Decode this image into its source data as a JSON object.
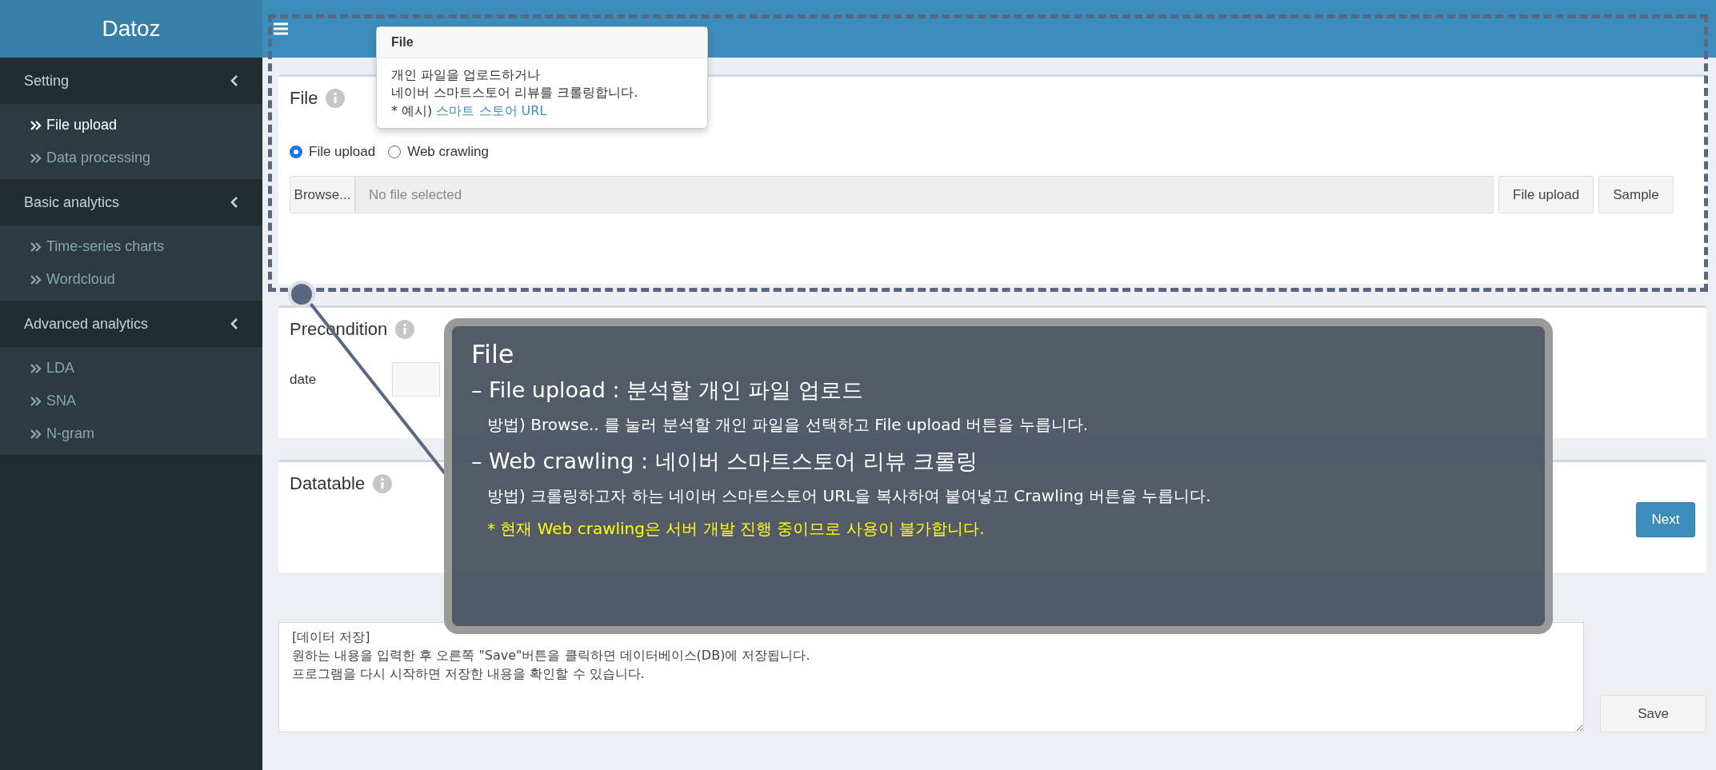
{
  "sidebar": {
    "logo": "Datoz",
    "groups": [
      {
        "label": "Setting",
        "items": [
          {
            "label": "File upload",
            "selected": true
          },
          {
            "label": "Data processing",
            "selected": false
          }
        ]
      },
      {
        "label": "Basic analytics",
        "items": [
          {
            "label": "Time-series charts",
            "selected": false
          },
          {
            "label": "Wordcloud",
            "selected": false
          }
        ]
      },
      {
        "label": "Advanced analytics",
        "items": [
          {
            "label": "LDA",
            "selected": false
          },
          {
            "label": "SNA",
            "selected": false
          },
          {
            "label": "N-gram",
            "selected": false
          }
        ]
      }
    ]
  },
  "file_box": {
    "title": "File",
    "radios": [
      {
        "label": "File upload",
        "selected": true
      },
      {
        "label": "Web crawling",
        "selected": false
      }
    ],
    "browse_button": "Browse...",
    "file_field": {
      "placeholder": "No file selected"
    },
    "buttons": [
      "File upload",
      "Sample"
    ]
  },
  "tooltip": {
    "title": "File",
    "lines": [
      "개인 파일을 업로드하거나",
      "네이버 스마트스토어 리뷰를 크롤링합니다."
    ],
    "example_prefix": "* 예시)",
    "example_link": "스마트 스토어 URL"
  },
  "precondition_box": {
    "title": "Precondition",
    "label": "date"
  },
  "datatable_box": {
    "title": "Datatable",
    "button": "Next"
  },
  "notes": {
    "value": "[데이터 저장]\n원하는 내용을 입력한 후 오른쪽 \"Save\"버튼을 클릭하면 데이터베이스(DB)에 저장됩니다.\n프로그램을 다시 시작하면 저장한 내용을 확인할 수 있습니다.",
    "button": "Save"
  },
  "guide": {
    "title": "File",
    "items": [
      {
        "kind": "heading",
        "text": "– File upload : 분석할 개인 파일 업로드"
      },
      {
        "kind": "detail",
        "text": "방법) Browse.. 를 눌러 분석할 개인 파일을 선택하고 File upload 버튼을 누릅니다."
      },
      {
        "kind": "heading",
        "text": "– Web crawling : 네이버 스마트스토어 리뷰 크롤링"
      },
      {
        "kind": "detail",
        "text": "방법) 크롤링하고자 하는 네이버 스마트스토어 URL을 복사하여 붙여넣고 Crawling 버튼을 누릅니다."
      },
      {
        "kind": "warning",
        "text": "* 현재 Web crawling은 서버 개발 진행 중이므로 사용이 불가합니다."
      }
    ]
  }
}
